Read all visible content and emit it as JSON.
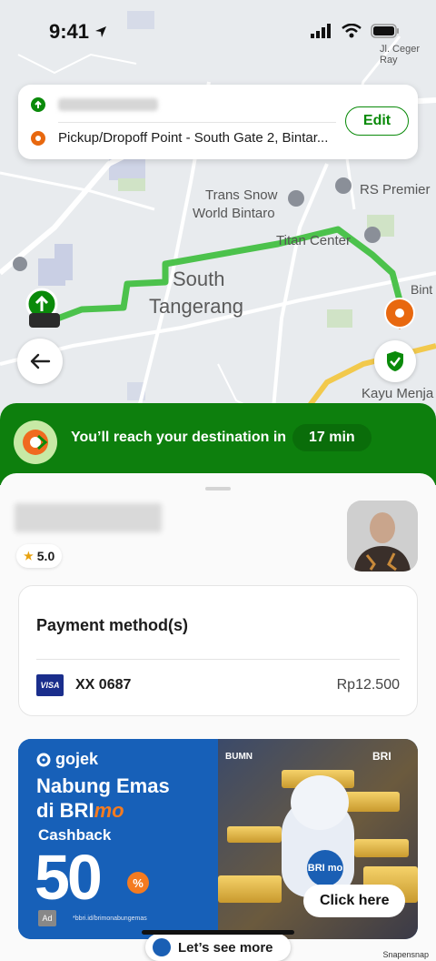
{
  "status_bar": {
    "time": "9:41"
  },
  "map": {
    "labels": {
      "street_ceger": "Jl. Ceger Ray",
      "trans_snow": "Trans Snow",
      "world_bintaro": "World Bintaro",
      "rs_premier": "RS Premier",
      "titan_center": "Titan Center",
      "south": "South",
      "tangerang": "Tangerang",
      "bint": "Bint",
      "kayu_menja": "Kayu Menja"
    }
  },
  "route_card": {
    "pickup_text": "",
    "dropoff_text": "Pickup/Dropoff Point - South Gate 2, Bintar...",
    "edit_label": "Edit"
  },
  "eta": {
    "text": "You’ll reach your destination in",
    "minutes": "17 min"
  },
  "driver": {
    "rating": "5.0"
  },
  "payment": {
    "title": "Payment method(s)",
    "card_brand": "VISA",
    "card_number": "XX 0687",
    "amount": "Rp12.500"
  },
  "ad": {
    "brand": "gojek",
    "headline_1": "Nabung Emas",
    "headline_2_prefix": "di BRI",
    "headline_2_suffix": "mo",
    "cashback": "Cashback",
    "percent": "50",
    "percent_sign": "%",
    "ad_tag": "Ad",
    "url": "*bbri.id/brimonabungemas",
    "bumn": "BUMN",
    "bri": "BRI",
    "mascot_badge": "BRI mo",
    "cta": "Click here"
  },
  "bottom": {
    "lets_see_more": "Let’s see more"
  },
  "watermark": "Snapensnap",
  "colors": {
    "gojek_green": "#0d7f0d",
    "route_green": "#4cc24c",
    "pin_orange": "#e8680f"
  }
}
